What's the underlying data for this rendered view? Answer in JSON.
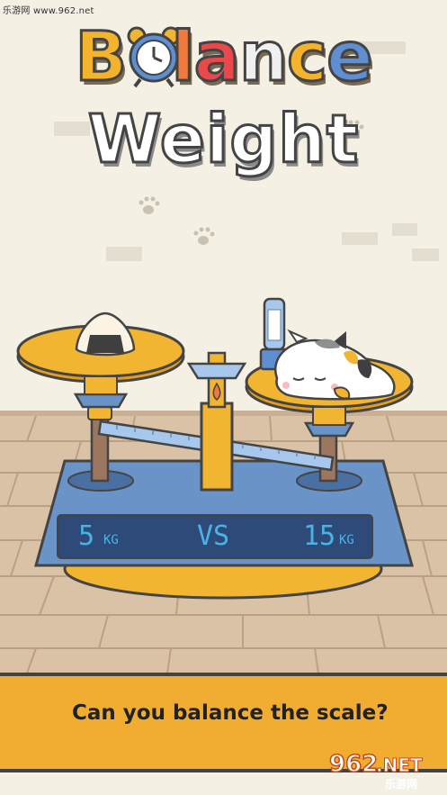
{
  "watermark_top": "乐游网 www.962.net",
  "title": {
    "line1_letters": [
      "B",
      "a",
      "l",
      "a",
      "n",
      "c",
      "e"
    ],
    "line2": "Weight"
  },
  "scale": {
    "left_weight": "5",
    "left_unit": "KG",
    "versus": "VS",
    "right_weight": "15",
    "right_unit": "KG"
  },
  "banner": {
    "text": "Can you balance the scale?"
  },
  "watermark_bottom": {
    "number": "962",
    "suffix": ".NET",
    "site": "乐游网"
  },
  "colors": {
    "background": "#f4f0e4",
    "floor": "#d9c2a6",
    "scale_base": "#6a93c8",
    "pan": "#f2b532",
    "banner": "#f0ad32",
    "lcd_text": "#48b3e6"
  },
  "icons": [
    "paw-icon",
    "alarm-clock-icon",
    "rice-ball-icon",
    "sleeping-cat-icon",
    "water-bottle-icon"
  ]
}
